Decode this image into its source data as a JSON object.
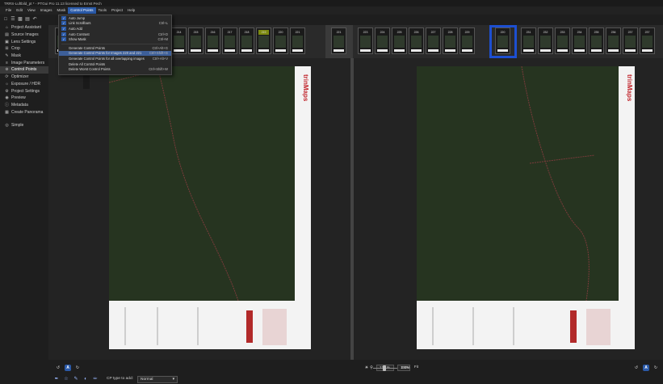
{
  "window": {
    "title": "TRRS-Luftbild_pt * - PTGui Pro 11.13 licensed to Ernst Pech"
  },
  "menu": [
    "File",
    "Edit",
    "View",
    "Images",
    "Mask",
    "Control Points",
    "Tools",
    "Project",
    "Help"
  ],
  "active_menu": "Control Points",
  "dropdown": {
    "items": [
      {
        "label": "Auto Jump",
        "shortcut": "",
        "checked": true
      },
      {
        "label": "Link Scrollbars",
        "shortcut": "Ctrl+L",
        "checked": true
      },
      {
        "label": "Auto Add",
        "shortcut": "",
        "checked": true
      },
      {
        "label": "Auto Contrast",
        "shortcut": "Ctrl+D",
        "checked": true
      },
      {
        "label": "Show Mask",
        "shortcut": "Ctrl+M",
        "checked": true
      },
      {
        "label": "Generate Control Points",
        "shortcut": "Ctrl+Alt+G",
        "checked": false
      },
      {
        "label": "Generate Control Points for Images 220 and 221",
        "shortcut": "Ctrl+Shift+G",
        "checked": false,
        "highlighted": true
      },
      {
        "label": "Generate Control Points for all overlapping images",
        "shortcut": "Ctrl+Alt+V",
        "checked": false
      },
      {
        "label": "Delete All Control Points",
        "shortcut": "",
        "checked": false
      },
      {
        "label": "Delete Worst Control Points",
        "shortcut": "Ctrl+Shift+W",
        "checked": false
      }
    ]
  },
  "sidebar": {
    "items": [
      {
        "icon": "home",
        "label": "Project Assistant"
      },
      {
        "icon": "image",
        "label": "Source Images"
      },
      {
        "icon": "lens",
        "label": "Lens Settings"
      },
      {
        "icon": "crop",
        "label": "Crop"
      },
      {
        "icon": "brush",
        "label": "Mask"
      },
      {
        "icon": "sliders",
        "label": "Image Parameters"
      },
      {
        "icon": "cp",
        "label": "Control Points",
        "active": true
      },
      {
        "icon": "refresh",
        "label": "Optimizer"
      },
      {
        "icon": "sun",
        "label": "Exposure / HDR"
      },
      {
        "icon": "gear",
        "label": "Project Settings"
      },
      {
        "icon": "eye",
        "label": "Preview"
      },
      {
        "icon": "info",
        "label": "Metadata"
      },
      {
        "icon": "grid",
        "label": "Create Panorama"
      }
    ],
    "simple_label": "Simple"
  },
  "filmstrip": {
    "left": [
      "214",
      "215",
      "216",
      "217",
      "218",
      "219",
      "220",
      "221"
    ],
    "right": [
      "223",
      "224",
      "225",
      "226",
      "227",
      "228",
      "229",
      "220",
      "231",
      "232",
      "233",
      "234",
      "235",
      "236",
      "237"
    ],
    "highlighted_left": "219",
    "selected_right": "220",
    "selected_left_frame": "221"
  },
  "bottom": {
    "zoom": "125 %",
    "zoom_100": "100%",
    "fit": "Fit",
    "ev": "0 EV",
    "cp_type_label": "CP type to add:",
    "cp_type_value": "Normal",
    "auto_label": "A"
  },
  "map_logo": "trinMaps"
}
